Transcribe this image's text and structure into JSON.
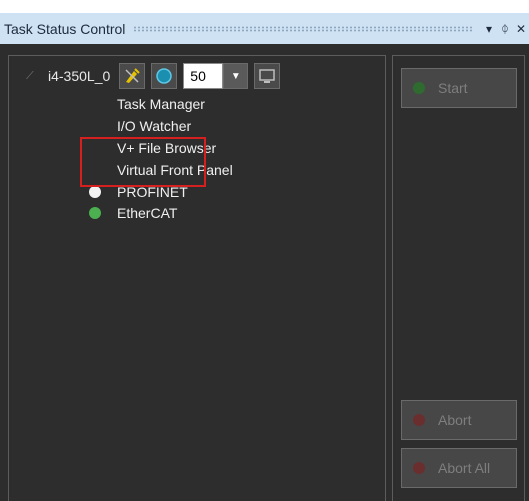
{
  "window": {
    "title": "Task Status Control",
    "dropdown_icon": "▾",
    "pin_icon": "ᛰ",
    "close_icon": "✕"
  },
  "robot": {
    "name": "i4-350L_0",
    "speed": "50"
  },
  "tree": {
    "items": [
      {
        "label": "Task Manager"
      },
      {
        "label": "I/O Watcher"
      },
      {
        "label": "V+ File Browser"
      },
      {
        "label": "Virtual Front Panel"
      }
    ],
    "status_items": [
      {
        "label": "PROFINET",
        "status_color": "#f2f2f2"
      },
      {
        "label": "EtherCAT",
        "status_color": "#4caf50"
      }
    ]
  },
  "controls": {
    "start_label": "Start",
    "abort_label": "Abort",
    "abort_all_label": "Abort All"
  },
  "colors": {
    "start_led": "#2f6b2f",
    "abort_led": "#6b2e2e",
    "highlight": "#d62020"
  }
}
